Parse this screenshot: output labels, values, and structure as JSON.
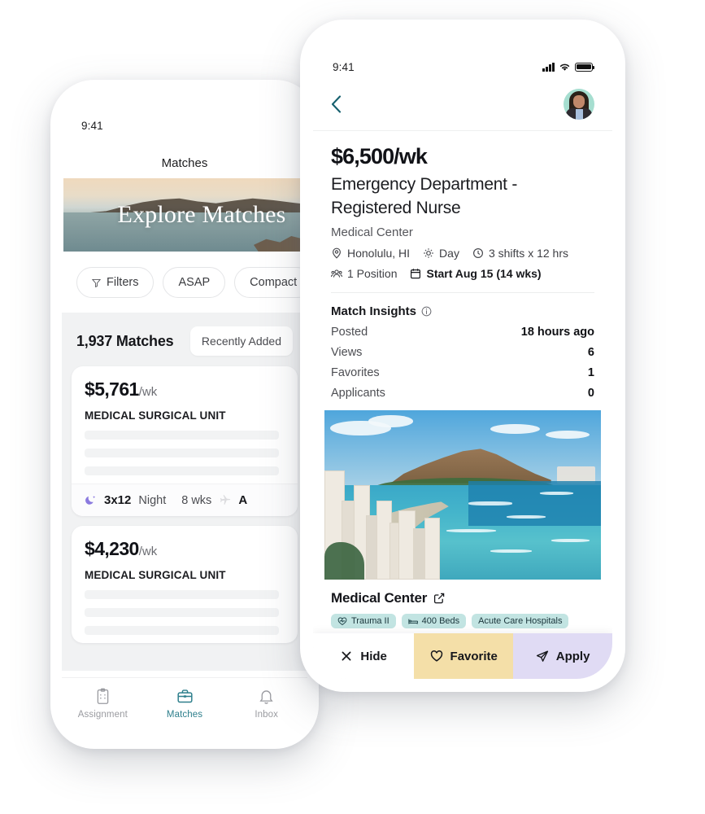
{
  "left_phone": {
    "status": {
      "time": "9:41"
    },
    "nav_title": "Matches",
    "hero": {
      "label": "Explore Matches"
    },
    "filters": [
      {
        "label": "Filters",
        "icon": "funnel-icon"
      },
      {
        "label": "ASAP",
        "icon": null
      },
      {
        "label": "Compact",
        "icon": null
      }
    ],
    "list_header": {
      "count": "1,937 Matches",
      "sort": "Recently Added"
    },
    "cards": [
      {
        "rate": "$5,761",
        "rate_unit": "/wk",
        "unit": "MEDICAL SURGICAL UNIT",
        "shift": "3x12",
        "shift_type": "Night",
        "duration": "8 wks",
        "travel": "A"
      },
      {
        "rate": "$4,230",
        "rate_unit": "/wk",
        "unit": "MEDICAL SURGICAL UNIT"
      }
    ],
    "tabs": [
      {
        "label": "Assignment",
        "icon": "clipboard-icon",
        "active": false
      },
      {
        "label": "Matches",
        "icon": "briefcase-icon",
        "active": true
      },
      {
        "label": "Inbox",
        "icon": "bell-icon",
        "active": false
      }
    ]
  },
  "right_phone": {
    "status": {
      "time": "9:41"
    },
    "header": {
      "back": "back-chevron-icon",
      "avatar": "user-avatar"
    },
    "job": {
      "rate": "$6,500/wk",
      "title_line1": "Emergency Department -",
      "title_line2": "Registered Nurse",
      "facility": "Medical Center",
      "meta": [
        {
          "icon": "location-pin-icon",
          "label": "Honolulu, HI",
          "strong": false
        },
        {
          "icon": "shift-gear-icon",
          "label": "Day",
          "strong": false
        },
        {
          "icon": "clock-icon",
          "label": "3 shifts x 12 hrs",
          "strong": false
        },
        {
          "icon": "people-icon",
          "label": "1 Position",
          "strong": false
        },
        {
          "icon": "calendar-icon",
          "label": "Start Aug 15 (14 wks)",
          "strong": true
        }
      ]
    },
    "insights": {
      "title": "Match Insights",
      "info_icon": "info-circle-icon",
      "rows": [
        {
          "label": "Posted",
          "value": "18 hours ago"
        },
        {
          "label": "Views",
          "value": "6"
        },
        {
          "label": "Favorites",
          "value": "1"
        },
        {
          "label": "Applicants",
          "value": "0"
        }
      ]
    },
    "facility_block": {
      "name": "Medical Center",
      "external_icon": "external-link-icon",
      "tags": [
        {
          "label": "Trauma II",
          "icon": "heart-monitor-icon"
        },
        {
          "label": "400 Beds",
          "icon": "bed-icon"
        },
        {
          "label": "Acute Care Hospitals",
          "icon": null
        }
      ]
    },
    "actions": [
      {
        "label": "Hide",
        "icon": "x-icon",
        "color": "#ffffff"
      },
      {
        "label": "Favorite",
        "icon": "heart-icon",
        "color": "#f4dfa8"
      },
      {
        "label": "Apply",
        "icon": "paper-plane-icon",
        "color": "#e0dbf4"
      }
    ]
  }
}
